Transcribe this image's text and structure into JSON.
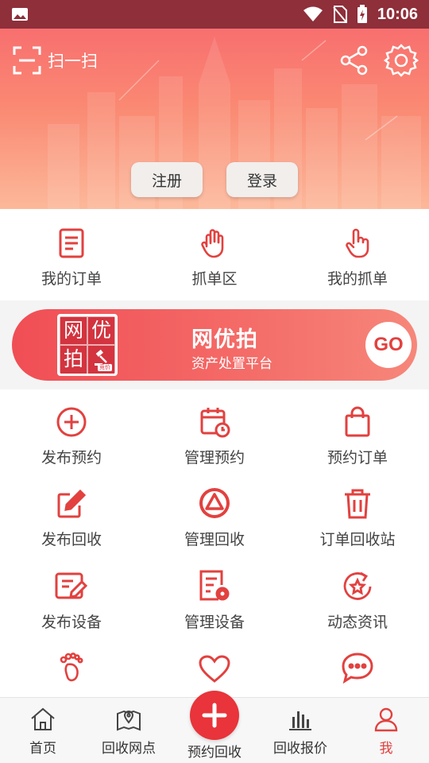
{
  "status_bar": {
    "time": "10:06"
  },
  "header": {
    "scan_label": "扫一扫",
    "register_label": "注册",
    "login_label": "登录"
  },
  "quick_menu": [
    {
      "label": "我的订单",
      "icon": "order-doc-icon"
    },
    {
      "label": "抓单区",
      "icon": "grab-hand-icon"
    },
    {
      "label": "我的抓单",
      "icon": "tap-hand-icon"
    }
  ],
  "banner": {
    "logo_chars": [
      "网",
      "优",
      "拍",
      ""
    ],
    "logo_tag": "竞价",
    "title": "网优拍",
    "subtitle": "资产处置平台",
    "go_label": "GO"
  },
  "services": [
    {
      "label": "发布预约",
      "icon": "plus-circle-icon"
    },
    {
      "label": "管理预约",
      "icon": "calendar-clock-icon"
    },
    {
      "label": "预约订单",
      "icon": "shopping-bag-icon"
    },
    {
      "label": "发布回收",
      "icon": "edit-icon"
    },
    {
      "label": "管理回收",
      "icon": "recycle-icon"
    },
    {
      "label": "订单回收站",
      "icon": "trash-icon"
    },
    {
      "label": "发布设备",
      "icon": "device-edit-icon"
    },
    {
      "label": "管理设备",
      "icon": "device-settings-icon"
    },
    {
      "label": "动态资讯",
      "icon": "star-refresh-icon"
    },
    {
      "label": "",
      "icon": "footprint-icon"
    },
    {
      "label": "",
      "icon": "heart-icon"
    },
    {
      "label": "",
      "icon": "chat-icon"
    }
  ],
  "tabbar": {
    "items": [
      {
        "label": "首页",
        "icon": "home-icon"
      },
      {
        "label": "回收网点",
        "icon": "map-pin-icon"
      },
      {
        "label": "预约回收",
        "icon": "plus-icon"
      },
      {
        "label": "回收报价",
        "icon": "bar-chart-icon"
      },
      {
        "label": "我",
        "icon": "user-icon"
      }
    ],
    "active_index": 4
  },
  "colors": {
    "accent": "#e2413f",
    "header_top": "#f86f6f",
    "header_bottom": "#fcb89a"
  }
}
